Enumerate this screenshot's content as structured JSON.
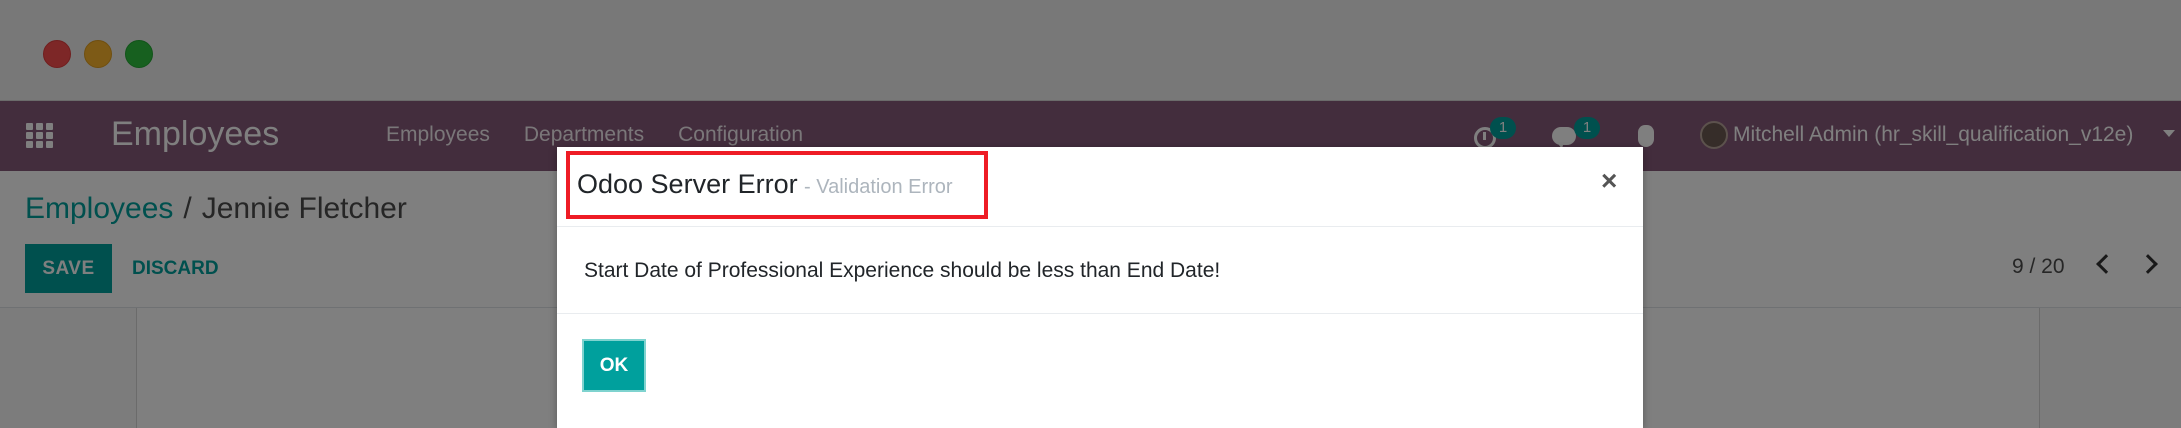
{
  "app": {
    "brand": "Employees",
    "menu": [
      "Employees",
      "Departments",
      "Configuration"
    ],
    "activity_count": "1",
    "message_count": "1",
    "user_name": "Mitchell Admin (hr_skill_qualification_v12e)"
  },
  "breadcrumb": {
    "parent": "Employees",
    "separator": "/",
    "current": "Jennie Fletcher"
  },
  "actions": {
    "save_label": "SAVE",
    "discard_label": "DISCARD"
  },
  "pager": {
    "value": "9 / 20"
  },
  "dialog": {
    "title": "Odoo Server Error",
    "subtitle": "- Validation Error",
    "close_glyph": "×",
    "message": "Start Date of Professional Experience should be less than End Date!",
    "ok_label": "OK"
  },
  "colors": {
    "navbar": "#875a7b",
    "accent": "#00a09d",
    "highlight": "#ee1c25"
  }
}
